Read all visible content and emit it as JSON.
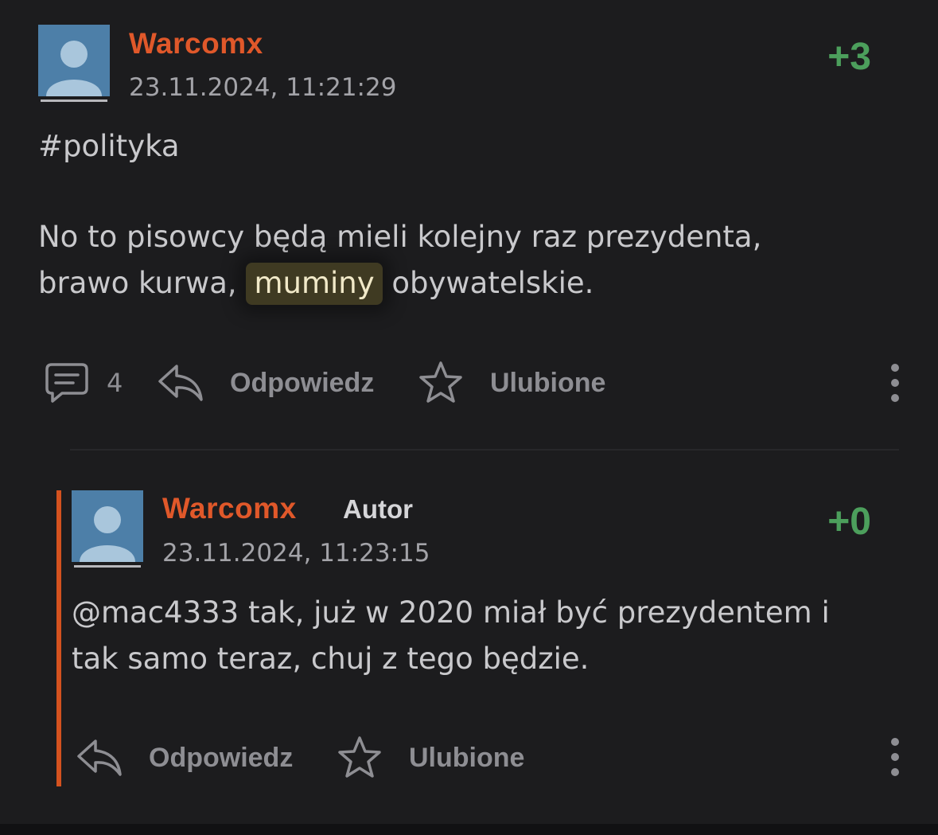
{
  "post": {
    "username": "Warcomx",
    "timestamp": "23.11.2024, 11:21:29",
    "score": "+3",
    "tag": "#polityka",
    "line1": "No to pisowcy będą mieli kolejny raz prezydenta,",
    "line2_before": "brawo kurwa, ",
    "line2_highlight": "muminy",
    "line2_after": " obywatelskie.",
    "comments_count": "4",
    "reply_label": "Odpowiedz",
    "favorite_label": "Ulubione"
  },
  "reply": {
    "username": "Warcomx",
    "author_badge": "Autor",
    "timestamp": "23.11.2024, 11:23:15",
    "score": "+0",
    "line1": "@mac4333 tak, już w 2020 miał być prezydentem i",
    "line2": "tak samo teraz, chuj z tego będzie.",
    "reply_label": "Odpowiedz",
    "favorite_label": "Ulubione"
  },
  "colors": {
    "background": "#1c1c1e",
    "username": "#e0582a",
    "score": "#4c9f5c",
    "reply_bar": "#d4521f",
    "highlight": "#3f3a22"
  },
  "icons": [
    "avatar-placeholder-icon",
    "comment-icon",
    "reply-arrow-icon",
    "star-icon",
    "more-vertical-icon"
  ]
}
